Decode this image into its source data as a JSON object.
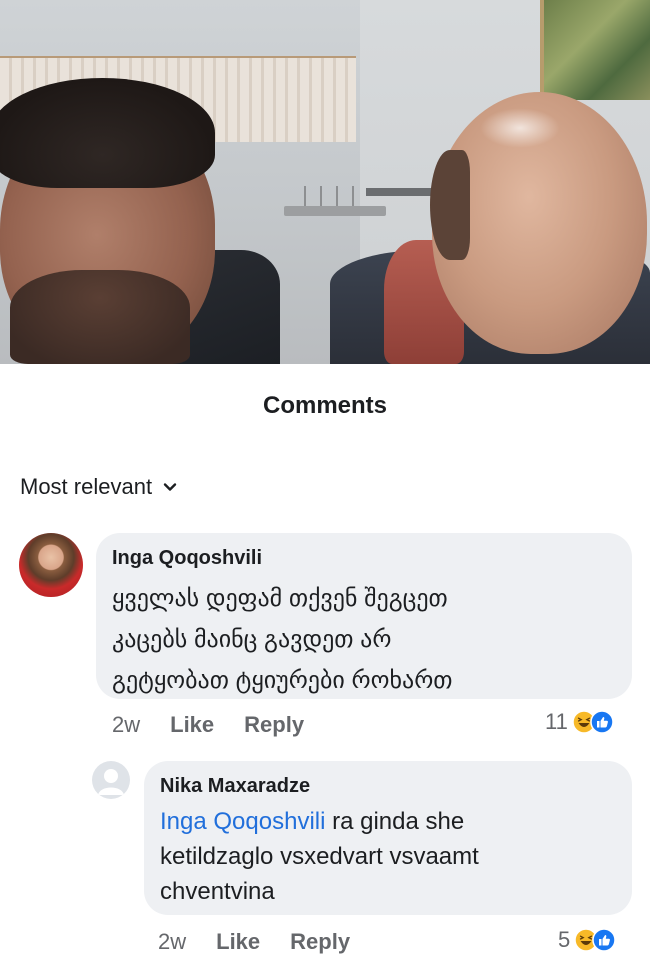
{
  "comments_header": {
    "title": "Comments"
  },
  "sort": {
    "label": "Most relevant",
    "icon": "chevron-down-icon"
  },
  "comments": [
    {
      "author": "Inga Qoqoshvili",
      "text_lines": [
        "ყველას დეფამ თქვენ შეგცეთ",
        "კაცებს მაინც გავდეთ არ",
        "გეტყობათ ტყიურები როხართ"
      ],
      "age": "2w",
      "like_label": "Like",
      "reply_label": "Reply",
      "reaction_count": "11",
      "reaction_icons": [
        "haha-icon",
        "like-icon"
      ]
    },
    {
      "author": "Nika Maxaradze",
      "mention": "Inga Qoqoshvili",
      "text_after_mention": " ra ginda she",
      "text_lines_rest": [
        "ketildzaglo vsxedvart vsvaamt",
        "chventvina"
      ],
      "age": "2w",
      "like_label": "Like",
      "reply_label": "Reply",
      "reaction_count": "5",
      "reaction_icons": [
        "haha-icon",
        "like-icon"
      ]
    }
  ],
  "colors": {
    "bubble": "#eef0f3",
    "mention": "#216fdb",
    "meta_text": "#65676b",
    "like_blue": "#1877f2",
    "haha_yellow": "#f7b928"
  }
}
